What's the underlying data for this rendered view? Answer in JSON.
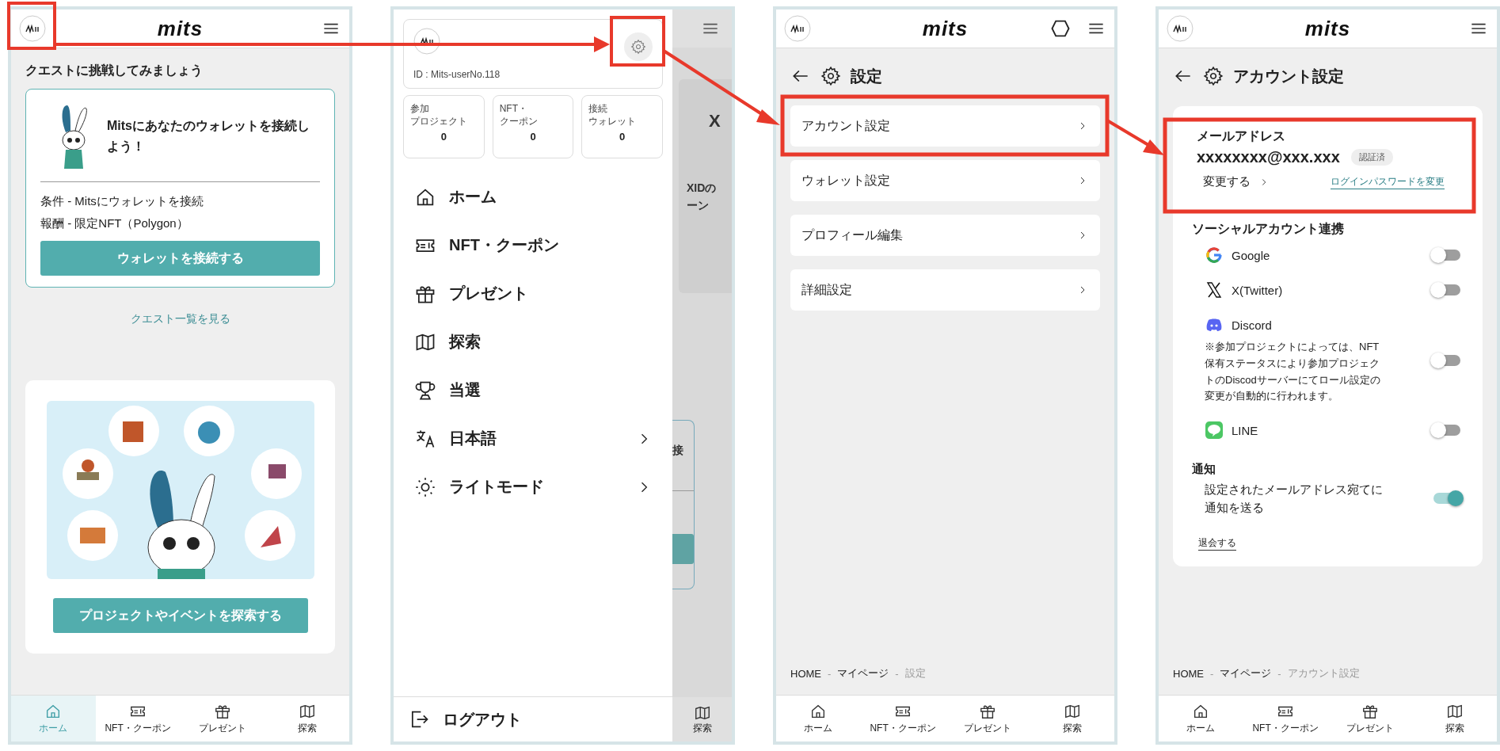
{
  "screens": [
    {
      "kind": "home",
      "header": {
        "logo": "mits"
      },
      "heading": "クエストに挑戦してみましょう",
      "quest": {
        "title": "Mitsにあなたのウォレットを接続しよう！",
        "condition": "条件 - Mitsにウォレットを接続",
        "reward": "報酬 - 限定NFT（Polygon）",
        "button": "ウォレットを接続する"
      },
      "quest_link": "クエスト一覧を見る",
      "promo_button": "プロジェクトやイベントを探索する",
      "nav": [
        {
          "label": "ホーム",
          "selected": true
        },
        {
          "label": "NFT・クーポン",
          "selected": false
        },
        {
          "label": "プレゼント",
          "selected": false
        },
        {
          "label": "探索",
          "selected": false
        }
      ]
    },
    {
      "kind": "drawer",
      "user_id": "ID : Mits-userNo.118",
      "stats": [
        {
          "label_lines": [
            "参加",
            "プロジェクト"
          ],
          "value": "0"
        },
        {
          "label_lines": [
            "NFT・",
            "クーポン"
          ],
          "value": "0"
        },
        {
          "label_lines": [
            "接続",
            "ウォレット"
          ],
          "value": "0"
        }
      ],
      "menu": [
        {
          "label": "ホーム",
          "submenu": false
        },
        {
          "label": "NFT・クーポン",
          "submenu": false
        },
        {
          "label": "プレゼント",
          "submenu": false
        },
        {
          "label": "探索",
          "submenu": false
        },
        {
          "label": "当選",
          "submenu": false
        },
        {
          "label": "日本語",
          "submenu": true
        },
        {
          "label": "ライトモード",
          "submenu": true
        }
      ],
      "logout": "ログアウト",
      "behind": {
        "card_initial": "X",
        "card_lines": [
          "XIDの",
          "ーン"
        ],
        "quest_fragment": "接",
        "nav_label": "探索"
      }
    },
    {
      "kind": "settings",
      "header": {
        "logo": "mits",
        "wallet_icon": true
      },
      "title": "設定",
      "items": [
        "アカウント設定",
        "ウォレット設定",
        "プロフィール編集",
        "詳細設定"
      ],
      "breadcrumb": {
        "separator": "-",
        "items": [
          {
            "label": "HOME",
            "current": false
          },
          {
            "label": "マイページ",
            "current": false
          },
          {
            "label": "設定",
            "current": true
          }
        ]
      },
      "nav": [
        {
          "label": "ホーム",
          "selected": false
        },
        {
          "label": "NFT・クーポン",
          "selected": false
        },
        {
          "label": "プレゼント",
          "selected": false
        },
        {
          "label": "探索",
          "selected": false
        }
      ]
    },
    {
      "kind": "account",
      "header": {
        "logo": "mits"
      },
      "title": "アカウント設定",
      "email": {
        "label": "メールアドレス",
        "value": "xxxxxxxx@xxx.xxx",
        "badge": "認証済",
        "change": "変更する",
        "password_link": "ログインパスワードを変更"
      },
      "social": {
        "title": "ソーシャルアカウント連携",
        "items": [
          {
            "label": "Google",
            "on": false
          },
          {
            "label": "X(Twitter)",
            "on": false
          },
          {
            "label": "Discord",
            "note": "※参加プロジェクトによっては、NFT保有ステータスにより参加プロジェクトのDiscodサーバーにてロール設定の変更が自動的に行われます。",
            "on": false
          },
          {
            "label": "LINE",
            "on": false
          }
        ]
      },
      "notify": {
        "title": "通知",
        "text": "設定されたメールアドレス宛てに通知を送る",
        "on": true
      },
      "withdraw": "退会する",
      "breadcrumb": {
        "separator": "-",
        "items": [
          {
            "label": "HOME",
            "current": false
          },
          {
            "label": "マイページ",
            "current": false
          },
          {
            "label": "アカウント設定",
            "current": true
          }
        ]
      },
      "nav": [
        {
          "label": "ホーム",
          "selected": false
        },
        {
          "label": "NFT・クーポン",
          "selected": false
        },
        {
          "label": "プレゼント",
          "selected": false
        },
        {
          "label": "探索",
          "selected": false
        }
      ]
    }
  ]
}
